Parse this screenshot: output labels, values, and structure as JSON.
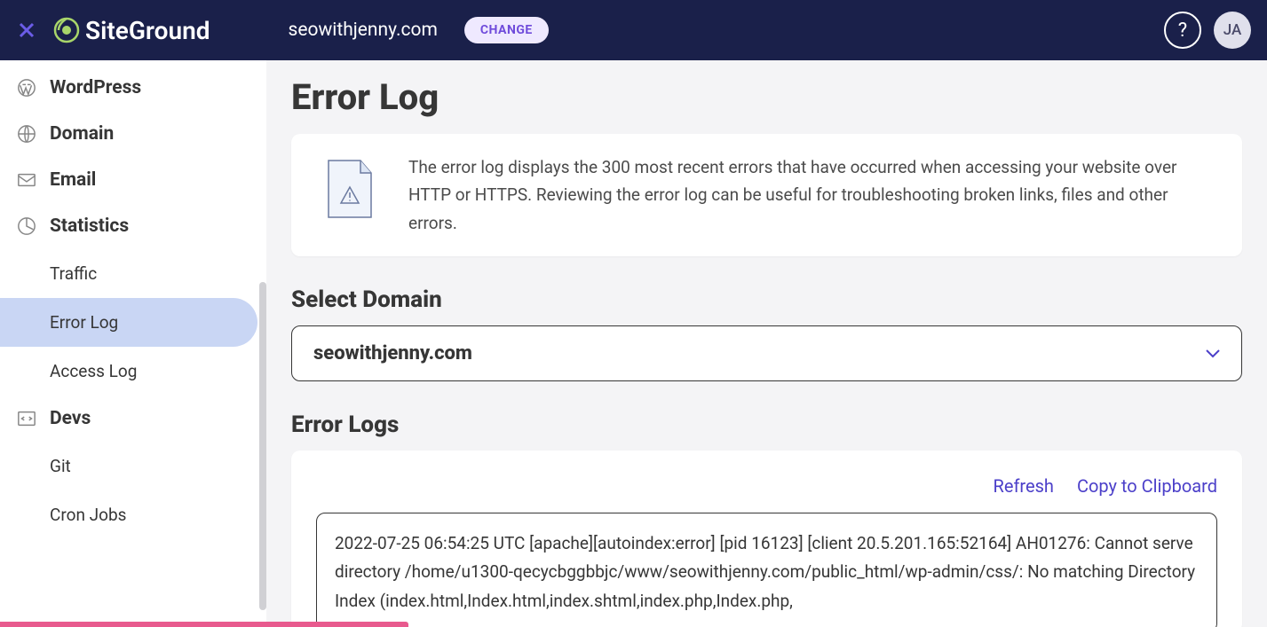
{
  "header": {
    "logo_text": "SiteGround",
    "domain": "seowithjenny.com",
    "change_label": "CHANGE",
    "help_glyph": "?",
    "avatar_initials": "JA"
  },
  "sidebar": {
    "items": [
      {
        "label": "WordPress",
        "icon": "wordpress"
      },
      {
        "label": "Domain",
        "icon": "globe"
      },
      {
        "label": "Email",
        "icon": "envelope"
      },
      {
        "label": "Statistics",
        "icon": "pie",
        "sub": [
          {
            "label": "Traffic",
            "active": false
          },
          {
            "label": "Error Log",
            "active": true
          },
          {
            "label": "Access Log",
            "active": false
          }
        ]
      },
      {
        "label": "Devs",
        "icon": "code",
        "sub": [
          {
            "label": "Git",
            "active": false
          },
          {
            "label": "Cron Jobs",
            "active": false
          }
        ]
      }
    ]
  },
  "main": {
    "title": "Error Log",
    "info_text": "The error log displays the 300 most recent errors that have occurred when accessing your website over HTTP or HTTPS. Reviewing the error log can be useful for troubleshooting broken links, files and other errors.",
    "select_domain_title": "Select Domain",
    "selected_domain": "seowithjenny.com",
    "error_logs_title": "Error Logs",
    "actions": {
      "refresh": "Refresh",
      "copy": "Copy to Clipboard"
    },
    "log_content": "2022-07-25 06:54:25 UTC [apache][autoindex:error] [pid 16123] [client 20.5.201.165:52164] AH01276: Cannot serve directory /home/u1300-qecycbggbbjc/www/seowithjenny.com/public_html/wp-admin/css/: No matching DirectoryIndex (index.html,Index.html,index.shtml,index.php,Index.php,"
  }
}
